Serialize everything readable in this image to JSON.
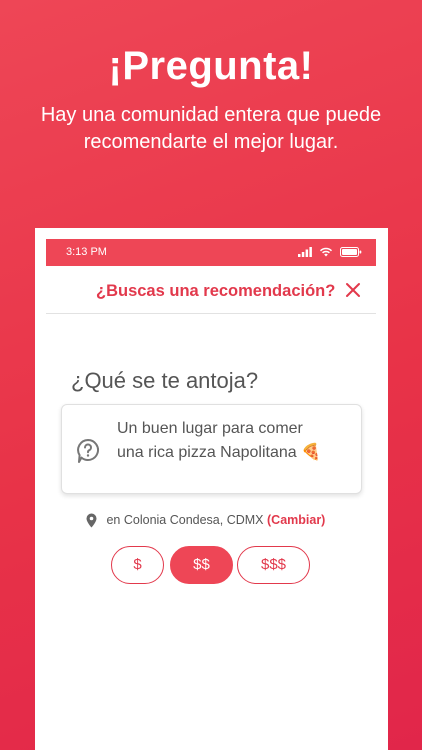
{
  "hero": {
    "title": "¡Pregunta!",
    "subtitle_line1": "Hay una comunidad entera que puede",
    "subtitle_line2": "recomendarte el mejor lugar."
  },
  "status_bar": {
    "time": "3:13 PM"
  },
  "modal": {
    "title": "¿Buscas una recomendación?",
    "close_icon": "close-icon"
  },
  "form": {
    "question": "¿Qué se te antoja?",
    "answer_line1": "Un buen lugar para comer",
    "answer_line2": "una rica pizza Napolitana 🍕",
    "answer_icon": "question-bubble-icon",
    "location_text": "en Colonia Condesa, CDMX",
    "location_change": "(Cambiar)"
  },
  "price_options": [
    {
      "label": "$",
      "selected": false
    },
    {
      "label": "$$",
      "selected": true
    },
    {
      "label": "$$$",
      "selected": false
    }
  ],
  "colors": {
    "brand": "#ee4656",
    "accent_text": "#e2394c"
  }
}
